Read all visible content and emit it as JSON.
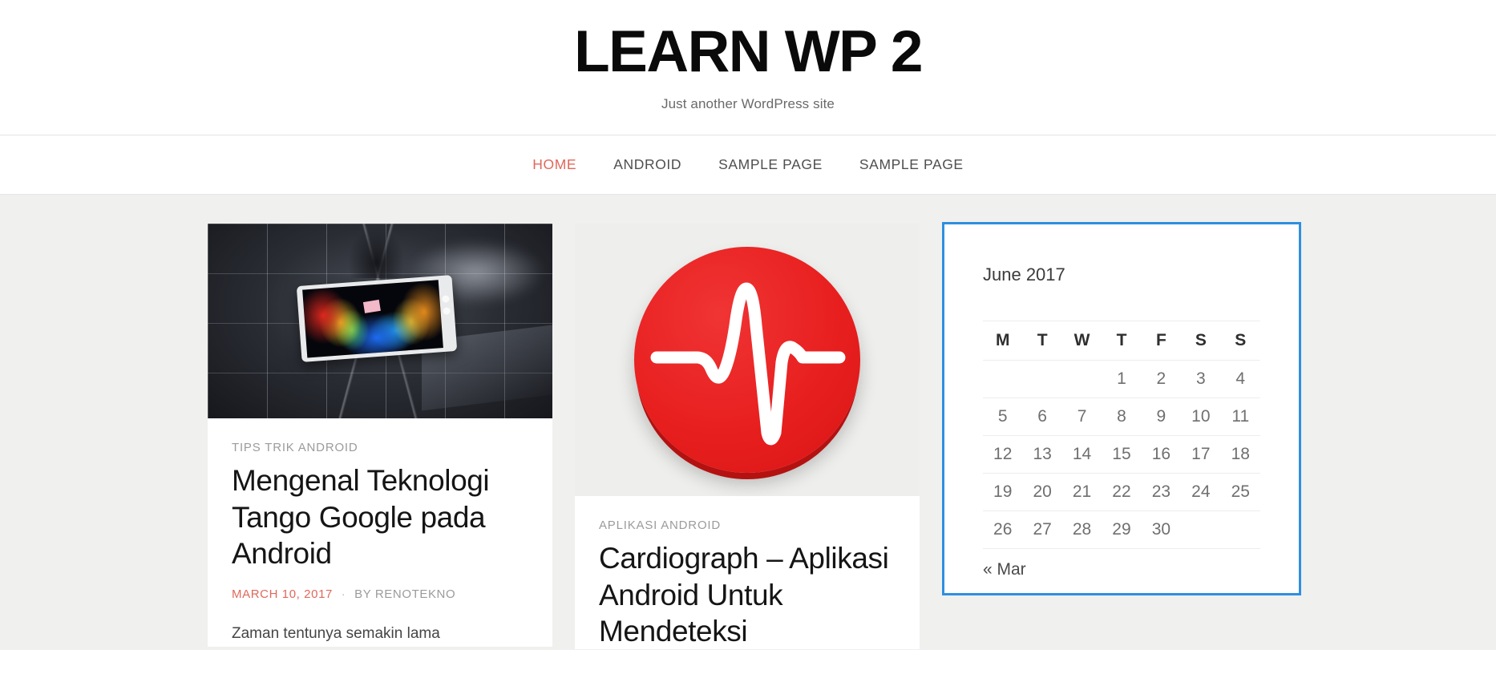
{
  "header": {
    "title": "LEARN WP 2",
    "tagline": "Just another WordPress site"
  },
  "nav": {
    "items": [
      {
        "label": "HOME",
        "current": true
      },
      {
        "label": "ANDROID",
        "current": false
      },
      {
        "label": "SAMPLE PAGE",
        "current": false
      },
      {
        "label": "SAMPLE PAGE",
        "current": false
      }
    ]
  },
  "posts": [
    {
      "category": "TIPS TRIK ANDROID",
      "title": "Mengenal Teknologi Tango Google pada Android",
      "date": "MARCH 10, 2017",
      "separator": "·",
      "author": "BY RENOTEKNO",
      "excerpt": "Zaman tentunya semakin lama",
      "thumbnail": "tango-tablet-depth-map-image"
    },
    {
      "category": "APLIKASI ANDROID",
      "title": "Cardiograph – Aplikasi Android Untuk Mendeteksi",
      "thumbnail": "cardiograph-red-ecg-logo"
    }
  ],
  "calendar": {
    "caption": "June 2017",
    "weekdays": [
      "M",
      "T",
      "W",
      "T",
      "F",
      "S",
      "S"
    ],
    "weeks": [
      [
        "",
        "",
        "",
        "1",
        "2",
        "3",
        "4"
      ],
      [
        "5",
        "6",
        "7",
        "8",
        "9",
        "10",
        "11"
      ],
      [
        "12",
        "13",
        "14",
        "15",
        "16",
        "17",
        "18"
      ],
      [
        "19",
        "20",
        "21",
        "22",
        "23",
        "24",
        "25"
      ],
      [
        "26",
        "27",
        "28",
        "29",
        "30",
        "",
        ""
      ]
    ],
    "prev_label": "« Mar"
  },
  "colors": {
    "accent": "#e0685b",
    "selection_border": "#2e8fe0",
    "page_background": "#f0f0ef",
    "card_background": "#ffffff"
  }
}
